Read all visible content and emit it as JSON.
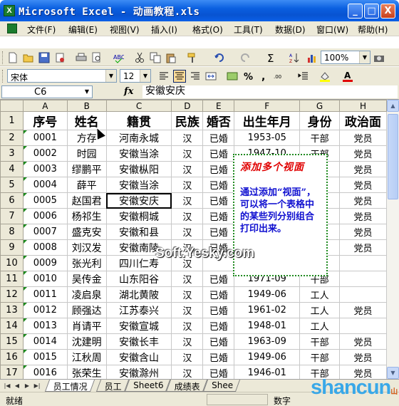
{
  "window": {
    "title": "Microsoft Excel - 动画教程.xls",
    "minimize": "_",
    "maximize": "□",
    "close": "X"
  },
  "menu": [
    "文件(F)",
    "编辑(E)",
    "视图(V)",
    "插入(I)",
    "格式(O)",
    "工具(T)",
    "数据(D)",
    "窗口(W)",
    "帮助(H)"
  ],
  "toolbar": {
    "zoom": "100%"
  },
  "format_toolbar": {
    "font": "宋体",
    "size": "12"
  },
  "formula_bar": {
    "cell_ref": "C6",
    "fx": "fx",
    "content": "安徽安庆"
  },
  "columns": [
    "A",
    "B",
    "C",
    "D",
    "E",
    "F",
    "G",
    "H"
  ],
  "header_row": [
    "序号",
    "姓名",
    "籍贯",
    "民族",
    "婚否",
    "出生年月",
    "身份",
    "政治面"
  ],
  "rows": [
    [
      "0001",
      "方存",
      "河南永城",
      "汉",
      "已婚",
      "1953-05",
      "干部",
      "党员"
    ],
    [
      "0002",
      "时园",
      "安徽当涂",
      "汉",
      "已婚",
      "1947-10",
      "干部",
      "党员"
    ],
    [
      "0003",
      "缪鹏平",
      "安徽枞阳",
      "汉",
      "已婚",
      "",
      "",
      "党员"
    ],
    [
      "0004",
      "薛平",
      "安徽当涂",
      "汉",
      "已婚",
      "",
      "",
      "党员"
    ],
    [
      "0005",
      "赵国君",
      "安徽安庆",
      "汉",
      "已婚",
      "",
      "",
      "党员"
    ],
    [
      "0006",
      "杨祁生",
      "安徽桐城",
      "汉",
      "已婚",
      "",
      "",
      "党员"
    ],
    [
      "0007",
      "盛克安",
      "安徽和县",
      "汉",
      "已婚",
      "",
      "",
      "党员"
    ],
    [
      "0008",
      "刘汉发",
      "安徽南陵",
      "汉",
      "已婚",
      "",
      "",
      "党员"
    ],
    [
      "0009",
      "张光利",
      "四川仁寿",
      "汉",
      "",
      "",
      "",
      ""
    ],
    [
      "0010",
      "吴传金",
      "山东阳谷",
      "汉",
      "已婚",
      "1971-09",
      "干部",
      ""
    ],
    [
      "0011",
      "凌启泉",
      "湖北黄陂",
      "汉",
      "已婚",
      "1949-06",
      "工人",
      ""
    ],
    [
      "0012",
      "顾强达",
      "江苏泰兴",
      "汉",
      "已婚",
      "1961-02",
      "工人",
      "党员"
    ],
    [
      "0013",
      "肖请平",
      "安徽宣城",
      "汉",
      "已婚",
      "1948-01",
      "工人",
      ""
    ],
    [
      "0014",
      "沈建明",
      "安徽长丰",
      "汉",
      "已婚",
      "1963-09",
      "干部",
      "党员"
    ],
    [
      "0015",
      "江秋周",
      "安徽含山",
      "汉",
      "已婚",
      "1949-06",
      "干部",
      "党员"
    ],
    [
      "0016",
      "张荣生",
      "安徽滁州",
      "汉",
      "已婚",
      "1946-01",
      "干部",
      "党员"
    ]
  ],
  "row_numbers": [
    "1",
    "2",
    "3",
    "4",
    "5",
    "6",
    "7",
    "8",
    "9",
    "10",
    "11",
    "12",
    "13",
    "14",
    "15",
    "16",
    "17"
  ],
  "callout": {
    "title": "添加多个视面",
    "body": "通过添加“视面”，可以将一个表格中的某些列分别组合打印出来。"
  },
  "sheet_tabs": [
    "员工情况",
    "员工",
    "Sheet6",
    "成绩表",
    "Shee"
  ],
  "status": {
    "ready": "就绪",
    "num": "数字"
  },
  "watermark": "Soft.Yesky.com",
  "logo": {
    "main": "shancun",
    "sub": "山村网"
  }
}
